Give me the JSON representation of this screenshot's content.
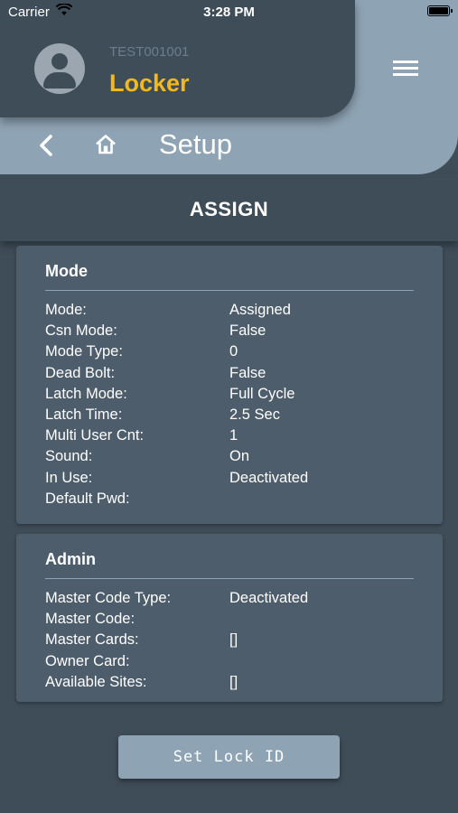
{
  "status_bar": {
    "carrier": "Carrier",
    "time": "3:28 PM"
  },
  "header": {
    "device_id": "TEST001001",
    "title": "Locker",
    "title_color": "#f2b81d"
  },
  "nav": {
    "title": "Setup"
  },
  "section": {
    "title": "ASSIGN"
  },
  "mode_panel": {
    "title": "Mode",
    "rows": [
      {
        "label": "Mode:",
        "value": "Assigned"
      },
      {
        "label": "Csn Mode:",
        "value": "False"
      },
      {
        "label": "Mode Type:",
        "value": "0"
      },
      {
        "label": "Dead Bolt:",
        "value": "False"
      },
      {
        "label": "Latch Mode:",
        "value": "Full Cycle"
      },
      {
        "label": "Latch Time:",
        "value": "2.5 Sec"
      },
      {
        "label": "Multi User Cnt:",
        "value": "1"
      },
      {
        "label": "Sound:",
        "value": "On"
      },
      {
        "label": "In Use:",
        "value": "Deactivated"
      },
      {
        "label": "Default Pwd:",
        "value": ""
      }
    ]
  },
  "admin_panel": {
    "title": "Admin",
    "rows": [
      {
        "label": "Master Code Type:",
        "value": "Deactivated"
      },
      {
        "label": "Master Code:",
        "value": ""
      },
      {
        "label": "Master Cards:",
        "value": "[]"
      },
      {
        "label": "Owner Card:",
        "value": ""
      },
      {
        "label": "Available Sites:",
        "value": "[]"
      }
    ]
  },
  "actions": {
    "set_lock_id": "Set Lock ID"
  },
  "icons": {
    "wifi": "wifi-icon",
    "battery": "battery-icon",
    "avatar": "user-avatar-icon",
    "menu": "hamburger-menu-icon",
    "back": "chevron-left-icon",
    "home": "home-icon"
  }
}
